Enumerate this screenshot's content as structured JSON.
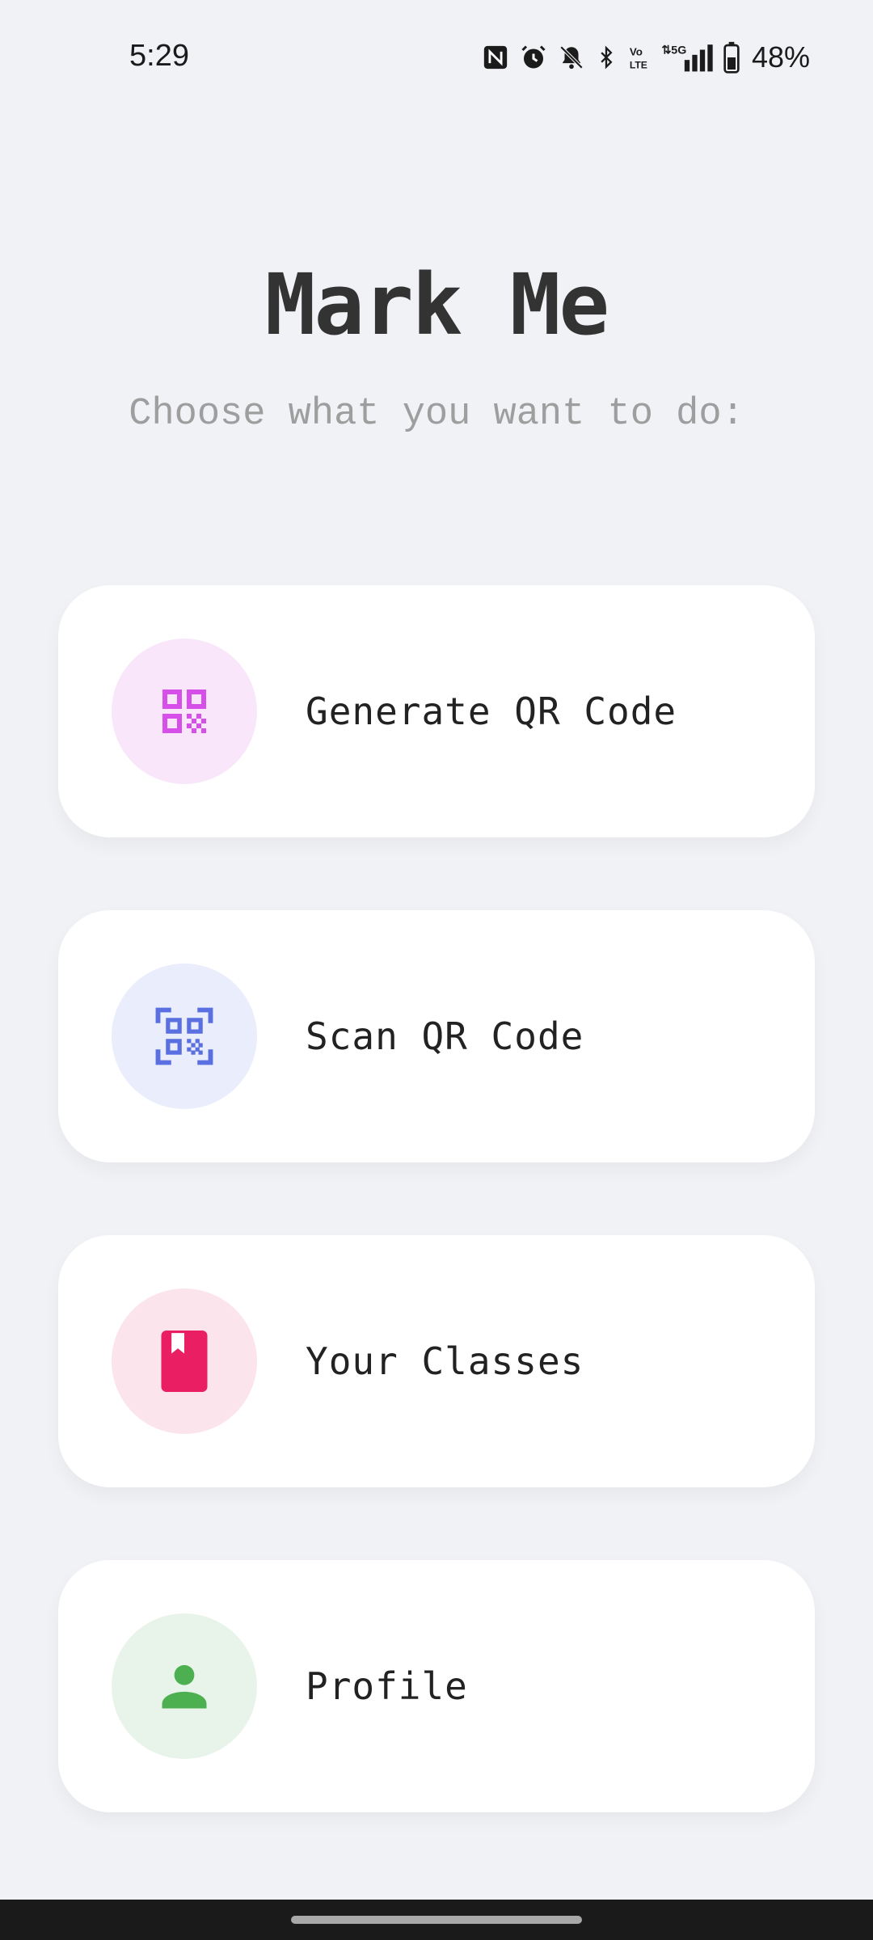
{
  "status_bar": {
    "time": "5:29",
    "icons": [
      "nfc-icon",
      "alarm-icon",
      "bell-off-icon",
      "bluetooth-icon",
      "volte-icon",
      "5g-signal-icon",
      "battery-icon"
    ],
    "battery_percent": "48%"
  },
  "header": {
    "title": "Mark Me",
    "subtitle": "Choose what you want to do:"
  },
  "menu": {
    "items": [
      {
        "label": "Generate QR Code",
        "icon": "qr-code-icon",
        "color": "#d64fe8",
        "bg": "#f9e6fb"
      },
      {
        "label": "Scan QR Code",
        "icon": "qr-scan-icon",
        "color": "#5a6fe0",
        "bg": "#e9edfc"
      },
      {
        "label": "Your Classes",
        "icon": "book-icon",
        "color": "#e91e63",
        "bg": "#fce4ec"
      },
      {
        "label": "Profile",
        "icon": "person-icon",
        "color": "#4caf50",
        "bg": "#e8f4ea"
      }
    ]
  },
  "colors": {
    "background": "#f1f2f5",
    "card": "#ffffff",
    "title": "#333333",
    "subtitle": "#9e9e9e"
  }
}
